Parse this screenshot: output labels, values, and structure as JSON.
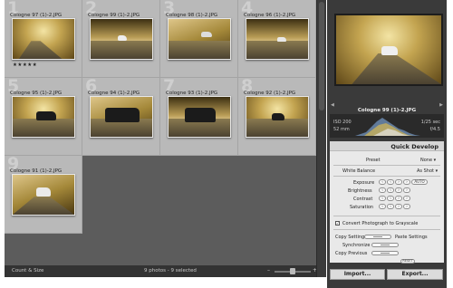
{
  "grid": {
    "cells": [
      {
        "index": "1",
        "name": "Cologne 97 (1)-2.JPG",
        "stars": "★★★★★"
      },
      {
        "index": "2",
        "name": "Cologne 99 (1)-2.JPG"
      },
      {
        "index": "3",
        "name": "Cologne 98 (1)-2.JPG"
      },
      {
        "index": "4",
        "name": "Cologne 96 (1)-2.JPG"
      },
      {
        "index": "5",
        "name": "Cologne 95 (1)-2.JPG"
      },
      {
        "index": "6",
        "name": "Cologne 94 (1)-2.JPG"
      },
      {
        "index": "7",
        "name": "Cologne 93 (1)-2.JPG"
      },
      {
        "index": "8",
        "name": "Cologne 92 (1)-2.JPG"
      },
      {
        "index": "9",
        "name": "Cologne 91 (1)-2.JPG"
      }
    ]
  },
  "status_bar": {
    "sort_label": "Count & Size",
    "selection_text": "9 photos - 9 selected",
    "zoom_minus": "–",
    "zoom_plus": "+"
  },
  "preview": {
    "title": "Cologne 99 (1)-2.JPG"
  },
  "histogram": {
    "iso": "ISO 200",
    "focal": "52 mm",
    "shutter": "1/25 sec",
    "aperture": "f/4.5"
  },
  "quick_develop": {
    "title": "Quick Develop",
    "preset_label": "Preset",
    "preset_value": "None",
    "wb_label": "White Balance",
    "wb_value": "As Shot",
    "exposure_label": "Exposure",
    "brightness_label": "Brightness",
    "contrast_label": "Contrast",
    "saturation_label": "Saturation",
    "auto_label": "AUTO",
    "grayscale_label": "Convert Photograph to Grayscale",
    "copy_settings_label": "Copy Settings",
    "paste_settings_label": "Paste Settings",
    "synchronize_label": "Synchronize",
    "copy_previous_label": "Copy Previous",
    "reset_label": "RESET"
  },
  "buttons": {
    "import": "Import...",
    "export": "Export..."
  },
  "colors": {
    "grid_bg": "#5c5c5c",
    "cell_bg": "#b9b9b9",
    "panel_bg": "#3a3a3a",
    "quick_develop_bg": "#e9e9e9"
  }
}
